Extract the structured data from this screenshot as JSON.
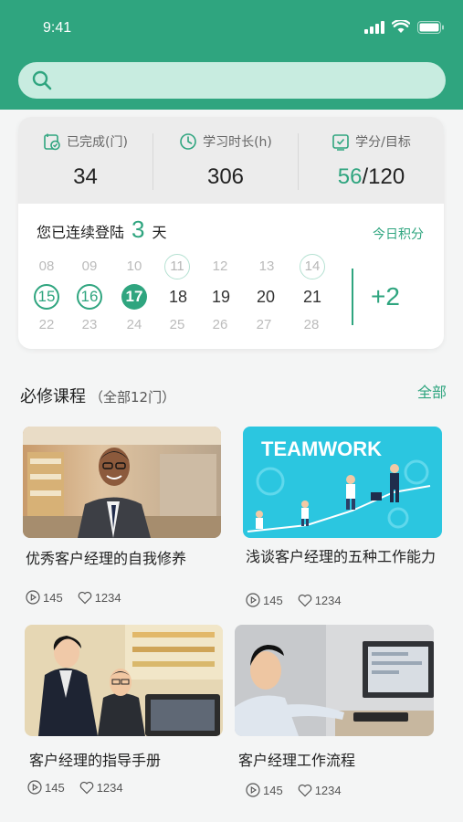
{
  "status_bar": {
    "time": "9:41"
  },
  "search": {
    "placeholder": ""
  },
  "stats": [
    {
      "label": "已完成(门)",
      "value": "34",
      "icon": "courses-done-icon"
    },
    {
      "label": "学习时长(h)",
      "value": "306",
      "icon": "clock-icon"
    },
    {
      "label": "学分/目标",
      "value_current": "56",
      "value_sep": "/",
      "value_target": "120",
      "icon": "credit-check-icon"
    }
  ],
  "checkin": {
    "prefix": "您已连续登陆",
    "days": "3",
    "suffix": "天",
    "today_points_label": "今日积分",
    "today_points": "+2",
    "calendar": [
      [
        "08",
        "09",
        "10",
        "11",
        "12",
        "13",
        "14"
      ],
      [
        "15",
        "16",
        "17",
        "18",
        "19",
        "20",
        "21"
      ],
      [
        "22",
        "23",
        "24",
        "25",
        "26",
        "27",
        "28"
      ]
    ]
  },
  "courses_section": {
    "title": "必修课程",
    "subtitle": "（全部12门）",
    "see_all": "全部"
  },
  "courses": [
    {
      "title": "优秀客户经理的自我修养",
      "plays": "145",
      "likes": "1234"
    },
    {
      "title": "浅谈客户经理的五种工作能力",
      "plays": "145",
      "likes": "1234",
      "image_text": "TEAMWORK"
    },
    {
      "title": "客户经理的指导手册",
      "plays": "145",
      "likes": "1234"
    },
    {
      "title": "客户经理工作流程",
      "plays": "145",
      "likes": "1234"
    }
  ],
  "colors": {
    "accent": "#2fa57f",
    "search_bg": "#c8ece0",
    "stats_bg": "#ececec"
  }
}
